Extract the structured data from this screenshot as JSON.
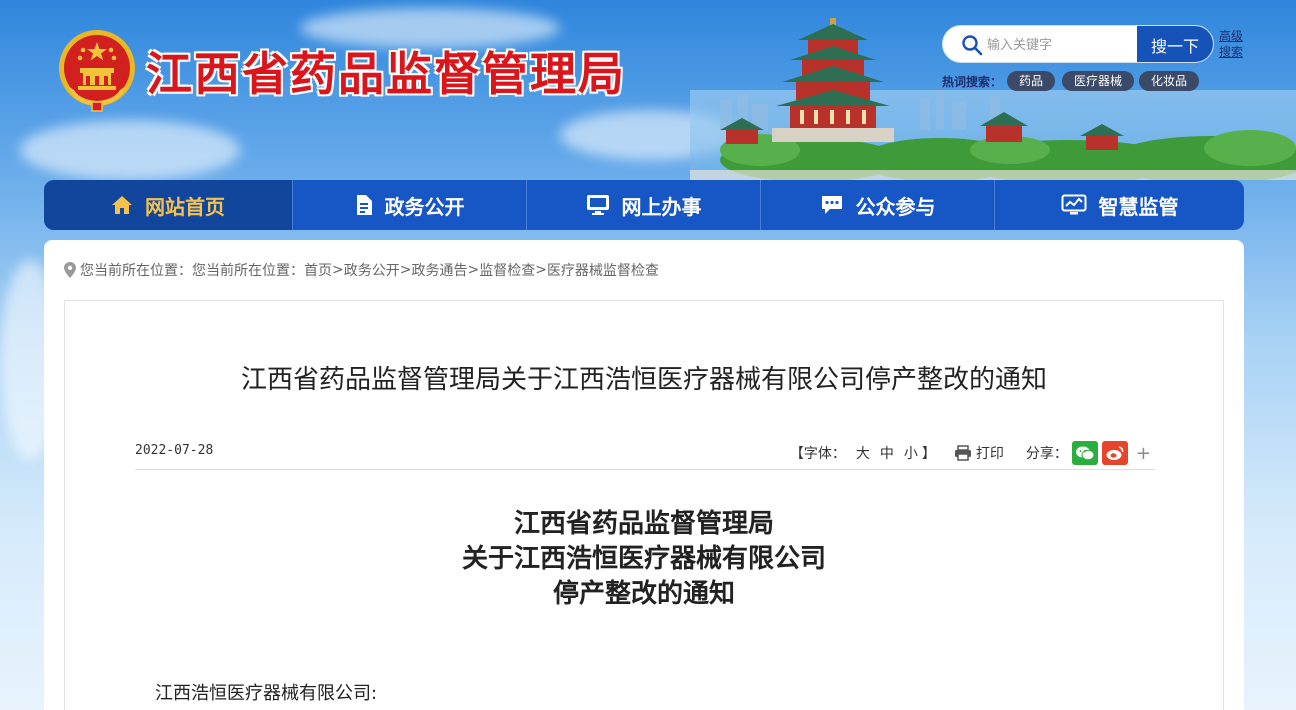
{
  "header": {
    "site_title": "江西省药品监督管理局",
    "search": {
      "placeholder": "输入关键字",
      "button_label": "搜一下",
      "advanced_label": "高级搜索"
    },
    "hot_search": {
      "label": "热词搜索：",
      "tags": [
        "药品",
        "医疗器械",
        "化妆品"
      ]
    }
  },
  "nav": {
    "items": [
      {
        "label": "网站首页",
        "icon": "home-icon",
        "active": true
      },
      {
        "label": "政务公开",
        "icon": "document-icon",
        "active": false
      },
      {
        "label": "网上办事",
        "icon": "monitor-icon",
        "active": false
      },
      {
        "label": "公众参与",
        "icon": "chat-icon",
        "active": false
      },
      {
        "label": "智慧监管",
        "icon": "dashboard-icon",
        "active": false
      }
    ]
  },
  "breadcrumb": {
    "prefix": "您当前所在位置：您当前所在位置：",
    "path": [
      "首页",
      "政务公开",
      "政务通告",
      "监督检查",
      "医疗器械监督检查"
    ]
  },
  "article": {
    "title": "江西省药品监督管理局关于江西浩恒医疗器械有限公司停产整改的通知",
    "date": "2022-07-28",
    "font_size_label": "【字体：",
    "font_sizes": [
      "大",
      "中",
      "小"
    ],
    "font_size_close": "】",
    "print_label": "打印",
    "share_label": "分享：",
    "heading_lines": [
      "江西省药品监督管理局",
      "关于江西浩恒医疗器械有限公司",
      "停产整改的通知"
    ],
    "salutation": "江西浩恒医疗器械有限公司:"
  },
  "colors": {
    "nav_bg": "#1756c5",
    "nav_active_bg": "#12459c",
    "nav_active_text": "#f5c24a",
    "title_red": "#d9161c",
    "search_button": "#1653b8",
    "wechat_green": "#2aae3f",
    "weibo_red": "#e6452b"
  }
}
